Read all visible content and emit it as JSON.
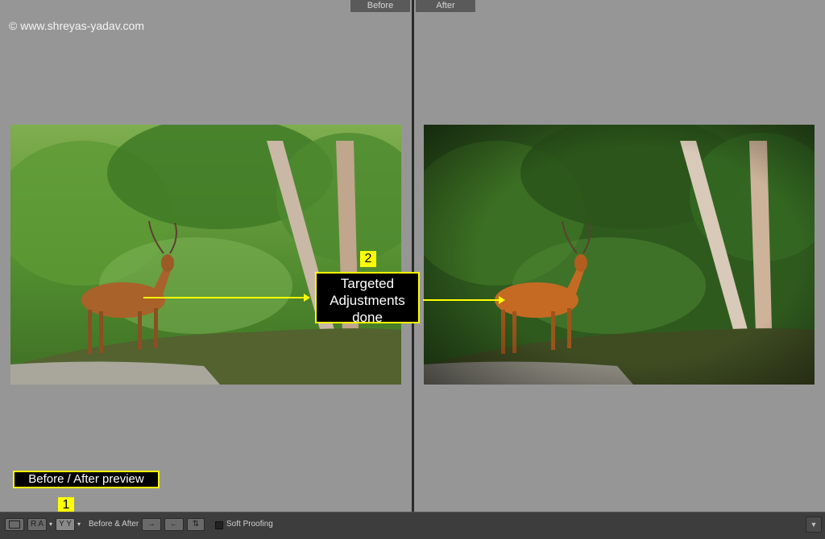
{
  "watermark": "© www.shreyas-yadav.com",
  "panes": {
    "before_label": "Before",
    "after_label": "After"
  },
  "callout": {
    "badge": "2",
    "line1": "Targeted",
    "line2": "Adjustments",
    "line3": "done"
  },
  "preview_note": {
    "badge": "1",
    "label": "Before / After preview"
  },
  "toolbar": {
    "loupe_icon": "single-view-icon",
    "ra_label": "R A",
    "yy_label": "Y Y",
    "before_after_label": "Before & After :",
    "copy_before_to_after": "→",
    "copy_after_to_before": "←",
    "swap": "⇅",
    "soft_proofing_label": "Soft Proofing",
    "soft_proofing_checked": false,
    "menu_icon": "chevron-down-icon"
  },
  "colors": {
    "annotation": "#ffff00",
    "background": "#969696",
    "toolbar": "#3d3d3d"
  }
}
